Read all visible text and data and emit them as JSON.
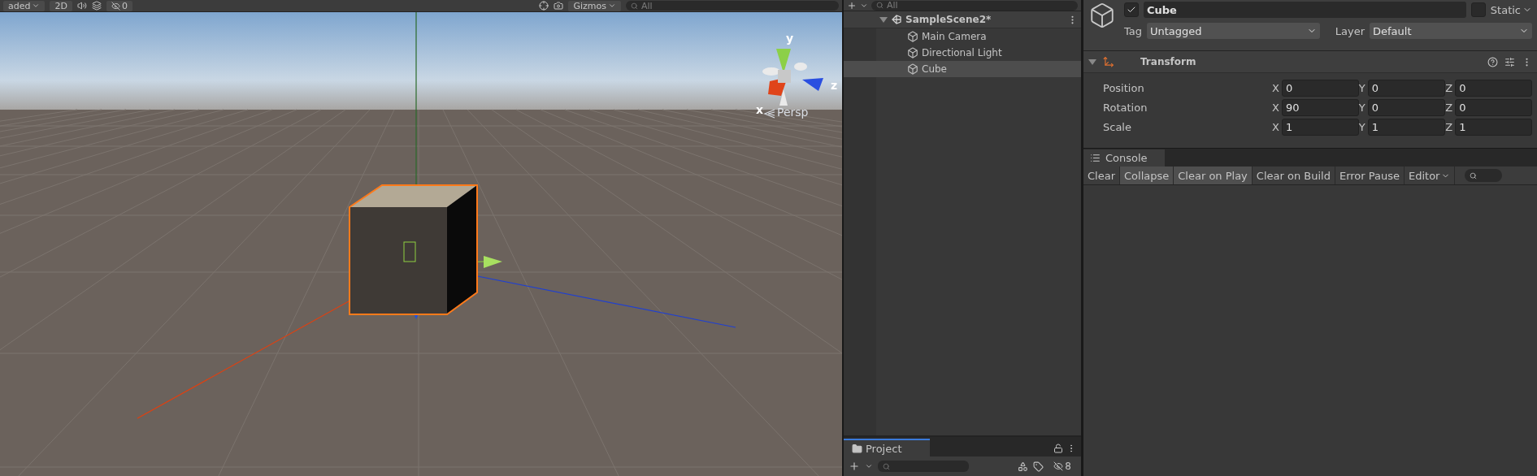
{
  "scene_view": {
    "toolbar": {
      "shading_mode": "aded",
      "mode_2d": "2D",
      "hidden_count": "0",
      "gizmos": "Gizmos",
      "search_placeholder": "All"
    },
    "orientation_gizmo": {
      "axis_labels": [
        "y",
        "x",
        "z"
      ],
      "projection": "Persp"
    }
  },
  "hierarchy": {
    "search_placeholder": "All",
    "scene": {
      "name": "SampleScene2*",
      "expanded": true,
      "children": [
        {
          "name": "Main Camera",
          "selected": false
        },
        {
          "name": "Directional Light",
          "selected": false
        },
        {
          "name": "Cube",
          "selected": true
        }
      ]
    }
  },
  "project": {
    "title": "Project",
    "hidden_count": "8"
  },
  "inspector": {
    "active": true,
    "name": "Cube",
    "static": false,
    "static_label": "Static",
    "tag_label": "Tag",
    "tag": "Untagged",
    "layer_label": "Layer",
    "layer": "Default",
    "component": {
      "title": "Transform",
      "expanded": true,
      "rows": [
        {
          "label": "Position",
          "values": [
            {
              "axis": "X",
              "value": "0"
            },
            {
              "axis": "Y",
              "value": "0"
            },
            {
              "axis": "Z",
              "value": "0"
            }
          ]
        },
        {
          "label": "Rotation",
          "values": [
            {
              "axis": "X",
              "value": "90"
            },
            {
              "axis": "Y",
              "value": "0"
            },
            {
              "axis": "Z",
              "value": "0"
            }
          ]
        },
        {
          "label": "Scale",
          "values": [
            {
              "axis": "X",
              "value": "1"
            },
            {
              "axis": "Y",
              "value": "1"
            },
            {
              "axis": "Z",
              "value": "1"
            }
          ]
        }
      ]
    }
  },
  "console": {
    "title": "Console",
    "buttons": [
      {
        "label": "Clear",
        "kind": "button",
        "selected": false
      },
      {
        "label": "Collapse",
        "kind": "toggle",
        "selected": true
      },
      {
        "label": "Clear on Play",
        "kind": "toggle",
        "selected": true
      },
      {
        "label": "Clear on Build",
        "kind": "toggle",
        "selected": false
      },
      {
        "label": "Error Pause",
        "kind": "toggle",
        "selected": false
      },
      {
        "label": "Editor",
        "kind": "dropdown",
        "selected": false
      }
    ]
  }
}
